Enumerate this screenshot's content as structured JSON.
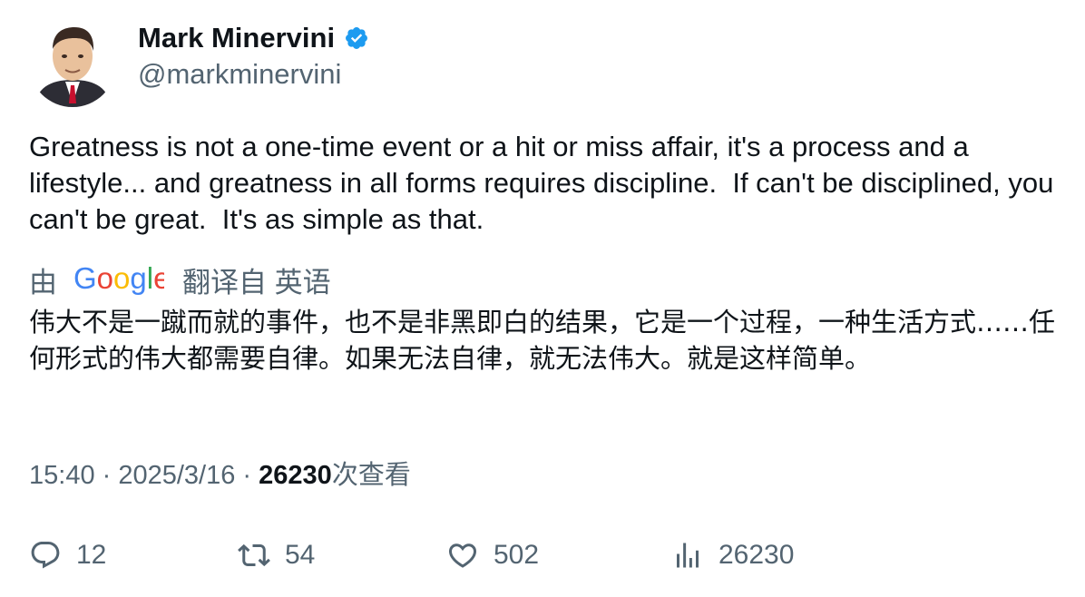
{
  "author": {
    "name": "Mark Minervini",
    "handle": "@markminervini",
    "verified": true
  },
  "tweet": {
    "text": "Greatness is not a one-time event or a hit or miss affair, it's a process and a lifestyle... and greatness in all forms requires discipline.  If can't be disciplined, you can't be great.  It's as simple as that."
  },
  "translation": {
    "prefix": "由",
    "provider": "Google",
    "suffix": "翻译自 英语",
    "text": "伟大不是一蹴而就的事件，也不是非黑即白的结果，它是一个过程，一种生活方式……任何形式的伟大都需要自律。如果无法自律，就无法伟大。就是这样简单。"
  },
  "meta": {
    "time": "15:40",
    "separator": " · ",
    "date": "2025/3/16",
    "views_count": "26230",
    "views_label": "次查看"
  },
  "actions": {
    "replies": "12",
    "retweets": "54",
    "likes": "502",
    "views": "26230"
  },
  "colors": {
    "text": "#0f1419",
    "secondary": "#536471",
    "verified": "#1d9bf0"
  }
}
